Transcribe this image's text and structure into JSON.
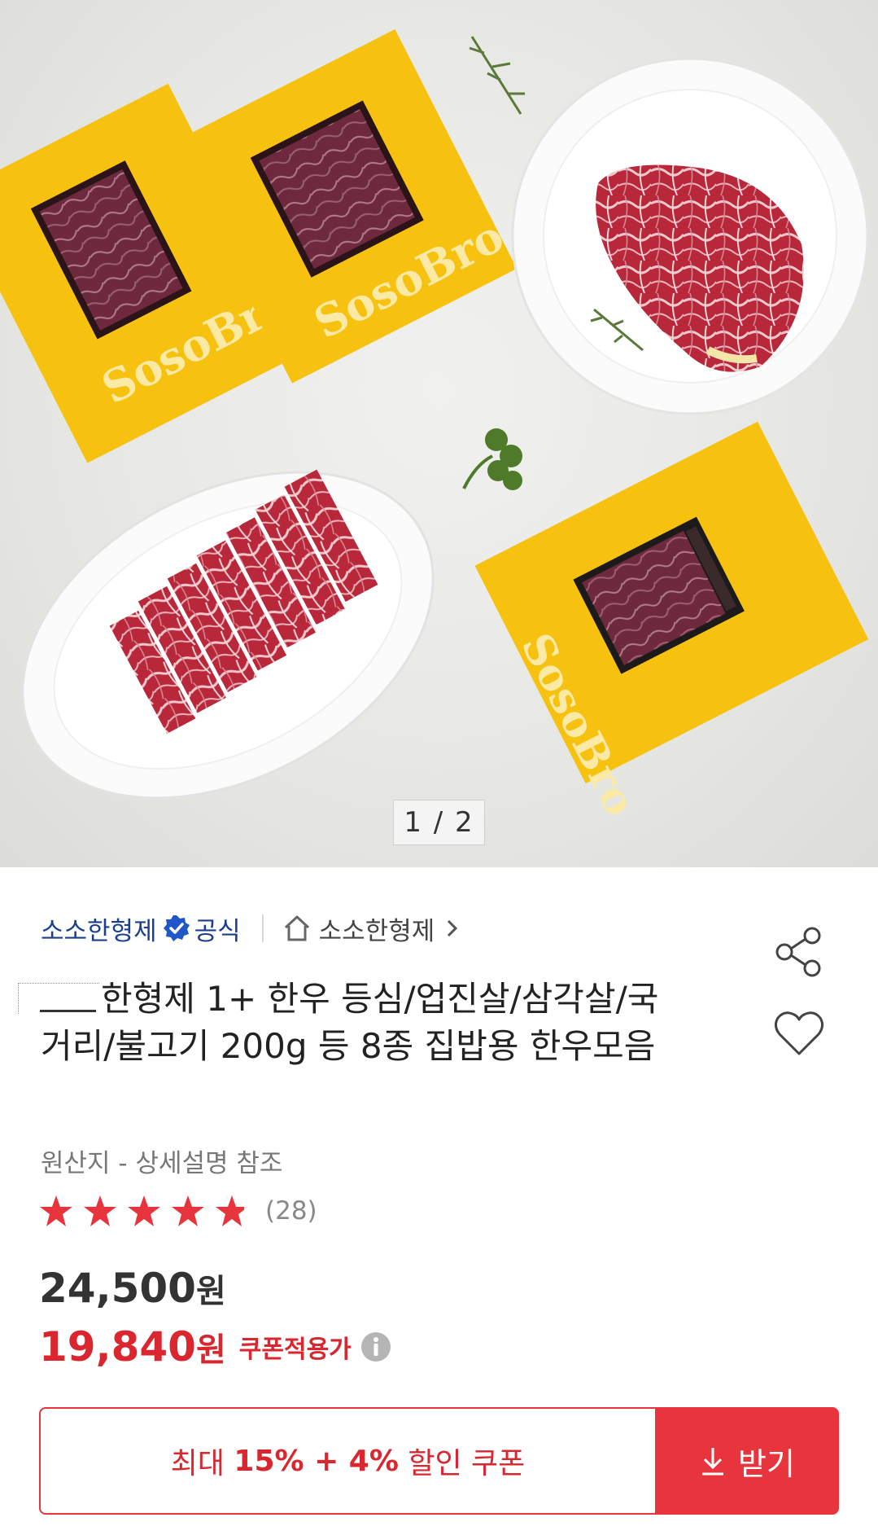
{
  "gallery": {
    "pager_text": "1 / 2",
    "brand_on_box": "SosoBro"
  },
  "seller": {
    "name": "소소한형제",
    "official_label": "공식",
    "store_name": "소소한형제"
  },
  "product": {
    "title_text": "한형제 1+ 한우 등심/업진살/삼각살/국거리/불고기 200g 등 8종 집밥용 한우모음",
    "origin": "원산지 - 상세설명 참조",
    "rating": 4.8,
    "review_count": "(28)"
  },
  "price": {
    "original_value": "24,500",
    "original_unit": "원",
    "sale_value": "19,840",
    "sale_unit": "원",
    "sale_label": "쿠폰적용가"
  },
  "coupon": {
    "text_prefix": "최대 ",
    "text_bold": "15% + 4%",
    "text_suffix": " 할인 쿠폰",
    "button_label": "받기"
  },
  "colors": {
    "accent_red": "#e8343d",
    "seller_blue": "#1a3f8f",
    "box_yellow": "#f6c20f"
  }
}
